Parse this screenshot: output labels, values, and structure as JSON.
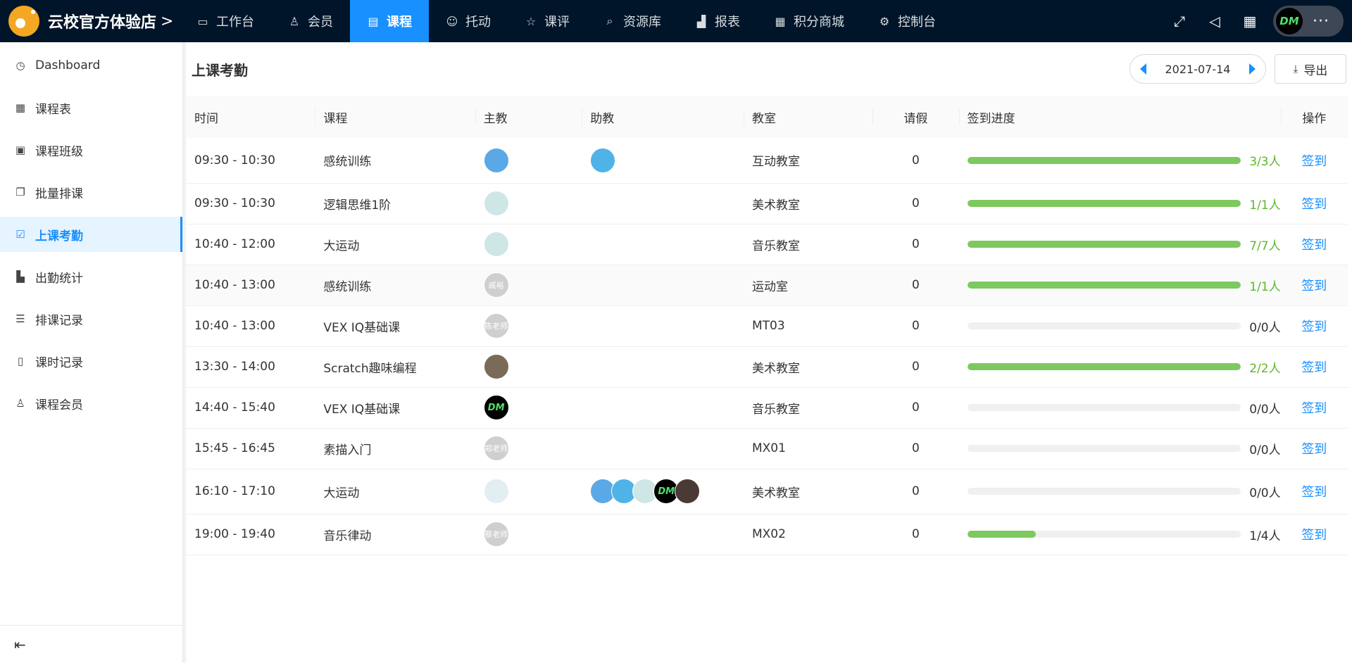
{
  "brand": {
    "name": "云校官方体验店",
    "chevron": ">"
  },
  "nav": [
    {
      "label": "工作台",
      "icon": "monitor-icon",
      "glyph": "▭",
      "active": false
    },
    {
      "label": "会员",
      "icon": "user-icon",
      "glyph": "♙",
      "active": false
    },
    {
      "label": "课程",
      "icon": "book-icon",
      "glyph": "▤",
      "active": true
    },
    {
      "label": "托动",
      "icon": "smile-icon",
      "glyph": "☺",
      "active": false
    },
    {
      "label": "课评",
      "icon": "star-icon",
      "glyph": "☆",
      "active": false
    },
    {
      "label": "资源库",
      "icon": "file-search-icon",
      "glyph": "⌕",
      "active": false
    },
    {
      "label": "报表",
      "icon": "chart-icon",
      "glyph": "▟",
      "active": false
    },
    {
      "label": "积分商城",
      "icon": "shop-icon",
      "glyph": "▦",
      "active": false
    },
    {
      "label": "控制台",
      "icon": "gear-icon",
      "glyph": "⚙",
      "active": false
    }
  ],
  "topright": {
    "avatar_text": "DM",
    "more": "···"
  },
  "sidebar": {
    "items": [
      {
        "label": "Dashboard",
        "icon": "dashboard-icon",
        "glyph": "◷",
        "active": false
      },
      {
        "label": "课程表",
        "icon": "calendar-icon",
        "glyph": "▦",
        "active": false
      },
      {
        "label": "课程班级",
        "icon": "class-icon",
        "glyph": "▣",
        "active": false
      },
      {
        "label": "批量排课",
        "icon": "copy-icon",
        "glyph": "❐",
        "active": false
      },
      {
        "label": "上课考勤",
        "icon": "checkin-icon",
        "glyph": "☑",
        "active": true
      },
      {
        "label": "出勤统计",
        "icon": "bar-chart-icon",
        "glyph": "▙",
        "active": false
      },
      {
        "label": "排课记录",
        "icon": "list-icon",
        "glyph": "☰",
        "active": false
      },
      {
        "label": "课时记录",
        "icon": "file-icon",
        "glyph": "▯",
        "active": false
      },
      {
        "label": "课程会员",
        "icon": "members-icon",
        "glyph": "♙",
        "active": false
      }
    ],
    "collapse_glyph": "⇤"
  },
  "page": {
    "title": "上课考勤",
    "date": "2021-07-14",
    "export_label": "导出"
  },
  "table": {
    "headers": [
      "时间",
      "课程",
      "主教",
      "助教",
      "教室",
      "请假",
      "签到进度",
      "操作"
    ],
    "rows": [
      {
        "time": "09:30 - 10:30",
        "course": "感统训练",
        "teacher": {
          "text": "",
          "color": "#5ba8e6"
        },
        "assistants": [
          {
            "text": "",
            "color": "#4fb3e8"
          }
        ],
        "room": "互动教室",
        "leave": "0",
        "progress": 1,
        "ptext": "3/3人",
        "op": "签到",
        "hl": false
      },
      {
        "time": "09:30 - 10:30",
        "course": "逻辑思维1阶",
        "teacher": {
          "text": "",
          "color": "#cfe6e6"
        },
        "assistants": [],
        "room": "美术教室",
        "leave": "0",
        "progress": 1,
        "ptext": "1/1人",
        "op": "签到",
        "hl": false
      },
      {
        "time": "10:40 - 12:00",
        "course": "大运动",
        "teacher": {
          "text": "",
          "color": "#cfe6e6"
        },
        "assistants": [],
        "room": "音乐教室",
        "leave": "0",
        "progress": 1,
        "ptext": "7/7人",
        "op": "签到",
        "hl": false
      },
      {
        "time": "10:40 - 13:00",
        "course": "感统训练",
        "teacher": {
          "text": "戚裕",
          "color": "#cfcfcf"
        },
        "assistants": [],
        "room": "运动室",
        "leave": "0",
        "progress": 1,
        "ptext": "1/1人",
        "op": "签到",
        "hl": true
      },
      {
        "time": "10:40 - 13:00",
        "course": "VEX IQ基础课",
        "teacher": {
          "text": "陈老师",
          "color": "#cfcfcf"
        },
        "assistants": [],
        "room": "MT03",
        "leave": "0",
        "progress": 0,
        "ptext": "0/0人",
        "op": "签到",
        "hl": false
      },
      {
        "time": "13:30 - 14:00",
        "course": "Scratch趣味编程",
        "teacher": {
          "text": "",
          "color": "#7a6a58"
        },
        "assistants": [],
        "room": "美术教室",
        "leave": "0",
        "progress": 1,
        "ptext": "2/2人",
        "op": "签到",
        "hl": false
      },
      {
        "time": "14:40 - 15:40",
        "course": "VEX IQ基础课",
        "teacher": {
          "text": "DM",
          "color": "#000000"
        },
        "assistants": [],
        "room": "音乐教室",
        "leave": "0",
        "progress": 0,
        "ptext": "0/0人",
        "op": "签到",
        "hl": false
      },
      {
        "time": "15:45 - 16:45",
        "course": "素描入门",
        "teacher": {
          "text": "郑老师",
          "color": "#cfcfcf"
        },
        "assistants": [],
        "room": "MX01",
        "leave": "0",
        "progress": 0,
        "ptext": "0/0人",
        "op": "签到",
        "hl": false
      },
      {
        "time": "16:10 - 17:10",
        "course": "大运动",
        "teacher": {
          "text": "",
          "color": "#e3eef2"
        },
        "assistants": [
          {
            "text": "",
            "color": "#5ba8e6"
          },
          {
            "text": "",
            "color": "#4fb3e8"
          },
          {
            "text": "",
            "color": "#cfe6e6"
          },
          {
            "text": "DM",
            "color": "#000000"
          },
          {
            "text": "",
            "color": "#4a3a35"
          }
        ],
        "room": "美术教室",
        "leave": "0",
        "progress": 0,
        "ptext": "0/0人",
        "op": "签到",
        "hl": false
      },
      {
        "time": "19:00 - 19:40",
        "course": "音乐律动",
        "teacher": {
          "text": "蔡老师",
          "color": "#cfcfcf"
        },
        "assistants": [],
        "room": "MX02",
        "leave": "0",
        "progress": 0.25,
        "ptext": "1/4人",
        "op": "签到",
        "hl": false
      }
    ]
  }
}
